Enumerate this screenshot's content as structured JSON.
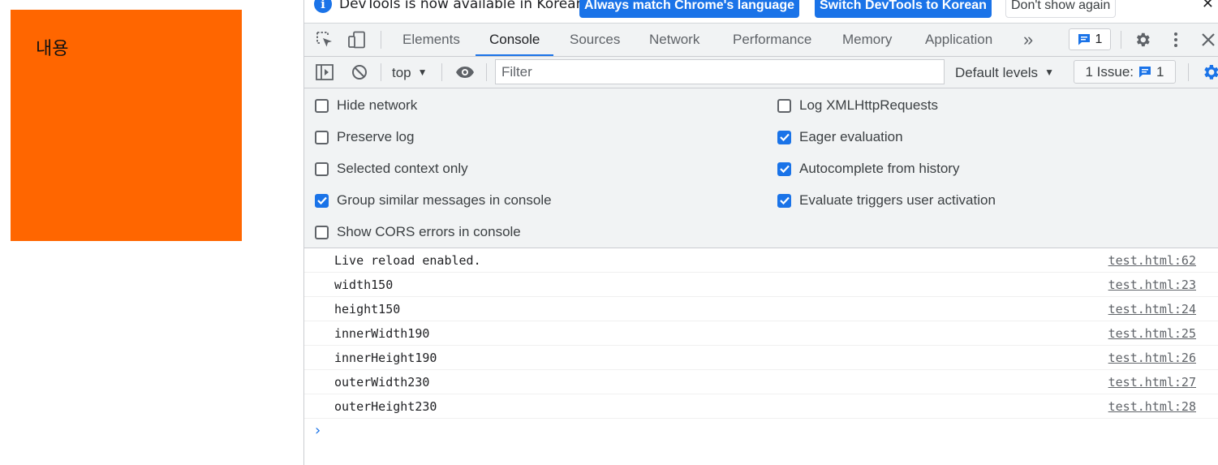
{
  "page": {
    "content_text": "내용",
    "box_color": "#ff6600"
  },
  "infobar": {
    "message": "DevTools is now available in Korean!",
    "match_label": "Always match Chrome's language",
    "switch_label": "Switch DevTools to Korean",
    "dismiss_label": "Don't show again",
    "close_symbol": "✕"
  },
  "tabs": {
    "items": [
      "Elements",
      "Console",
      "Sources",
      "Network",
      "Performance",
      "Memory",
      "Application"
    ],
    "active": "Console",
    "more_symbol": "»",
    "issues_count": "1"
  },
  "toolbar": {
    "context": "top",
    "filter_placeholder": "Filter",
    "levels": "Default levels",
    "issue_label": "1 Issue:",
    "issue_count": "1"
  },
  "settings": {
    "hide_network": {
      "label": "Hide network",
      "checked": false
    },
    "preserve_log": {
      "label": "Preserve log",
      "checked": false
    },
    "selected_context": {
      "label": "Selected context only",
      "checked": false
    },
    "group_similar": {
      "label": "Group similar messages in console",
      "checked": true
    },
    "show_cors": {
      "label": "Show CORS errors in console",
      "checked": false
    },
    "log_xhr": {
      "label": "Log XMLHttpRequests",
      "checked": false
    },
    "eager_eval": {
      "label": "Eager evaluation",
      "checked": true
    },
    "autocomplete": {
      "label": "Autocomplete from history",
      "checked": true
    },
    "user_activation": {
      "label": "Evaluate triggers user activation",
      "checked": true
    }
  },
  "console": {
    "messages": [
      {
        "text": "Live reload enabled.",
        "source": "test.html:62"
      },
      {
        "text": "width150",
        "source": "test.html:23"
      },
      {
        "text": "height150",
        "source": "test.html:24"
      },
      {
        "text": "innerWidth190",
        "source": "test.html:25"
      },
      {
        "text": "innerHeight190",
        "source": "test.html:26"
      },
      {
        "text": "outerWidth230",
        "source": "test.html:27"
      },
      {
        "text": "outerHeight230",
        "source": "test.html:28"
      }
    ],
    "prompt_symbol": "›"
  },
  "colors": {
    "accent": "#1a73e8",
    "panel_bg": "#f1f3f4",
    "border": "#cbcdd1"
  }
}
